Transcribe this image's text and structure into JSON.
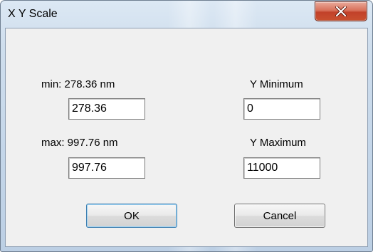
{
  "window": {
    "title": "X Y Scale",
    "close_icon": "close-x-icon"
  },
  "x_axis": {
    "min_label": "min: 278.36 nm",
    "min_value": "278.36",
    "max_label": "max: 997.76 nm",
    "max_value": "997.76"
  },
  "y_axis": {
    "min_label": "Y Minimum",
    "min_value": "0",
    "max_label": "Y Maximum",
    "max_value": "11000"
  },
  "buttons": {
    "ok_label": "OK",
    "cancel_label": "Cancel"
  },
  "colors": {
    "frame": "#c4d6e9",
    "close_button": "#c9502f",
    "dialog_face": "#f0f0f0"
  }
}
